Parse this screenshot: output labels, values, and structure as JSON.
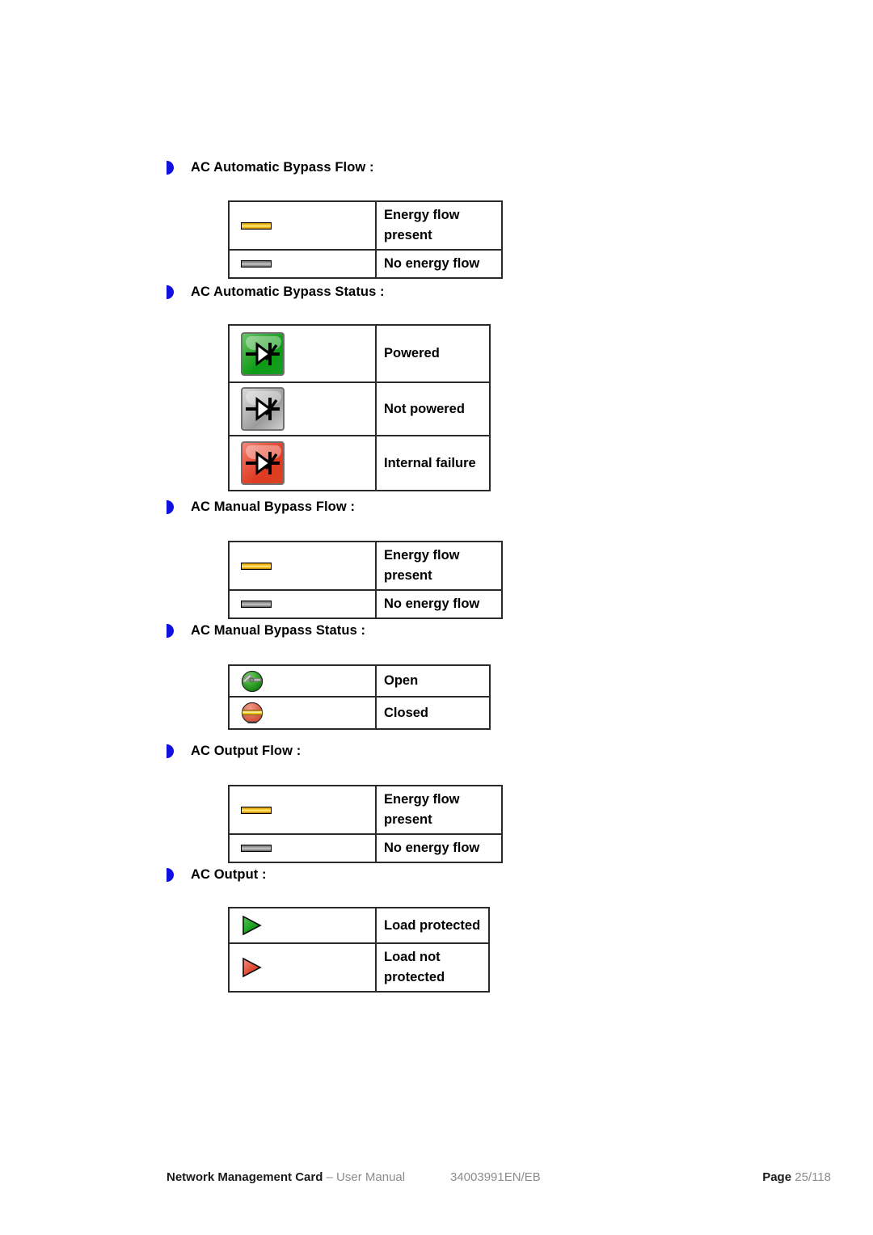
{
  "document": {
    "type": "user-manual-page",
    "footer": {
      "title": "Network Management Card",
      "title_suffix": " – User Manual",
      "doc_code": "34003991EN/EB",
      "page_label": "Page",
      "page_number": "25/118"
    }
  },
  "colors": {
    "bullet": "#1010E0",
    "energy_flow": "#F4C220",
    "no_energy_flow": "#9A9A9A",
    "powered_green": "#0C9C16",
    "not_powered_gray": "#9B9B9B",
    "failure_red": "#E03A22",
    "open_green": "#2E9E2E",
    "closed_red": "#E0604C",
    "footer_muted": "#8C8C8C"
  },
  "sections": [
    {
      "heading": "AC Automatic Bypass Flow :",
      "rows": [
        {
          "icon": "energy-flow-bar-icon",
          "label": "Energy flow",
          "label_line2": "present"
        },
        {
          "icon": "no-energy-flow-bar-icon",
          "label": "No energy flow",
          "label_line2": ""
        }
      ]
    },
    {
      "heading": "AC Automatic Bypass Status :",
      "rows": [
        {
          "icon": "thyristor-green-icon",
          "label": "Powered",
          "label_line2": ""
        },
        {
          "icon": "thyristor-gray-icon",
          "label": "Not powered",
          "label_line2": ""
        },
        {
          "icon": "thyristor-red-icon",
          "label": "Internal failure",
          "label_line2": ""
        }
      ]
    },
    {
      "heading": "AC Manual Bypass Flow :",
      "rows": [
        {
          "icon": "energy-flow-bar-icon",
          "label": "Energy flow",
          "label_line2": "present"
        },
        {
          "icon": "no-energy-flow-bar-icon",
          "label": "No energy flow",
          "label_line2": ""
        }
      ]
    },
    {
      "heading": "AC Manual Bypass Status :",
      "rows": [
        {
          "icon": "switch-open-icon",
          "label": "Open",
          "label_line2": ""
        },
        {
          "icon": "switch-closed-icon",
          "label": "Closed",
          "label_line2": ""
        }
      ]
    },
    {
      "heading": "AC Output Flow :",
      "rows": [
        {
          "icon": "energy-flow-bar-icon",
          "label": "Energy flow",
          "label_line2": "present"
        },
        {
          "icon": "no-energy-flow-bar-icon",
          "label": "No energy flow",
          "label_line2": ""
        }
      ]
    },
    {
      "heading": "AC Output :",
      "rows": [
        {
          "icon": "arrow-green-icon",
          "label": "Load protected",
          "label_line2": ""
        },
        {
          "icon": "arrow-red-icon",
          "label": "Load not",
          "label_line2": "protected"
        }
      ]
    }
  ]
}
